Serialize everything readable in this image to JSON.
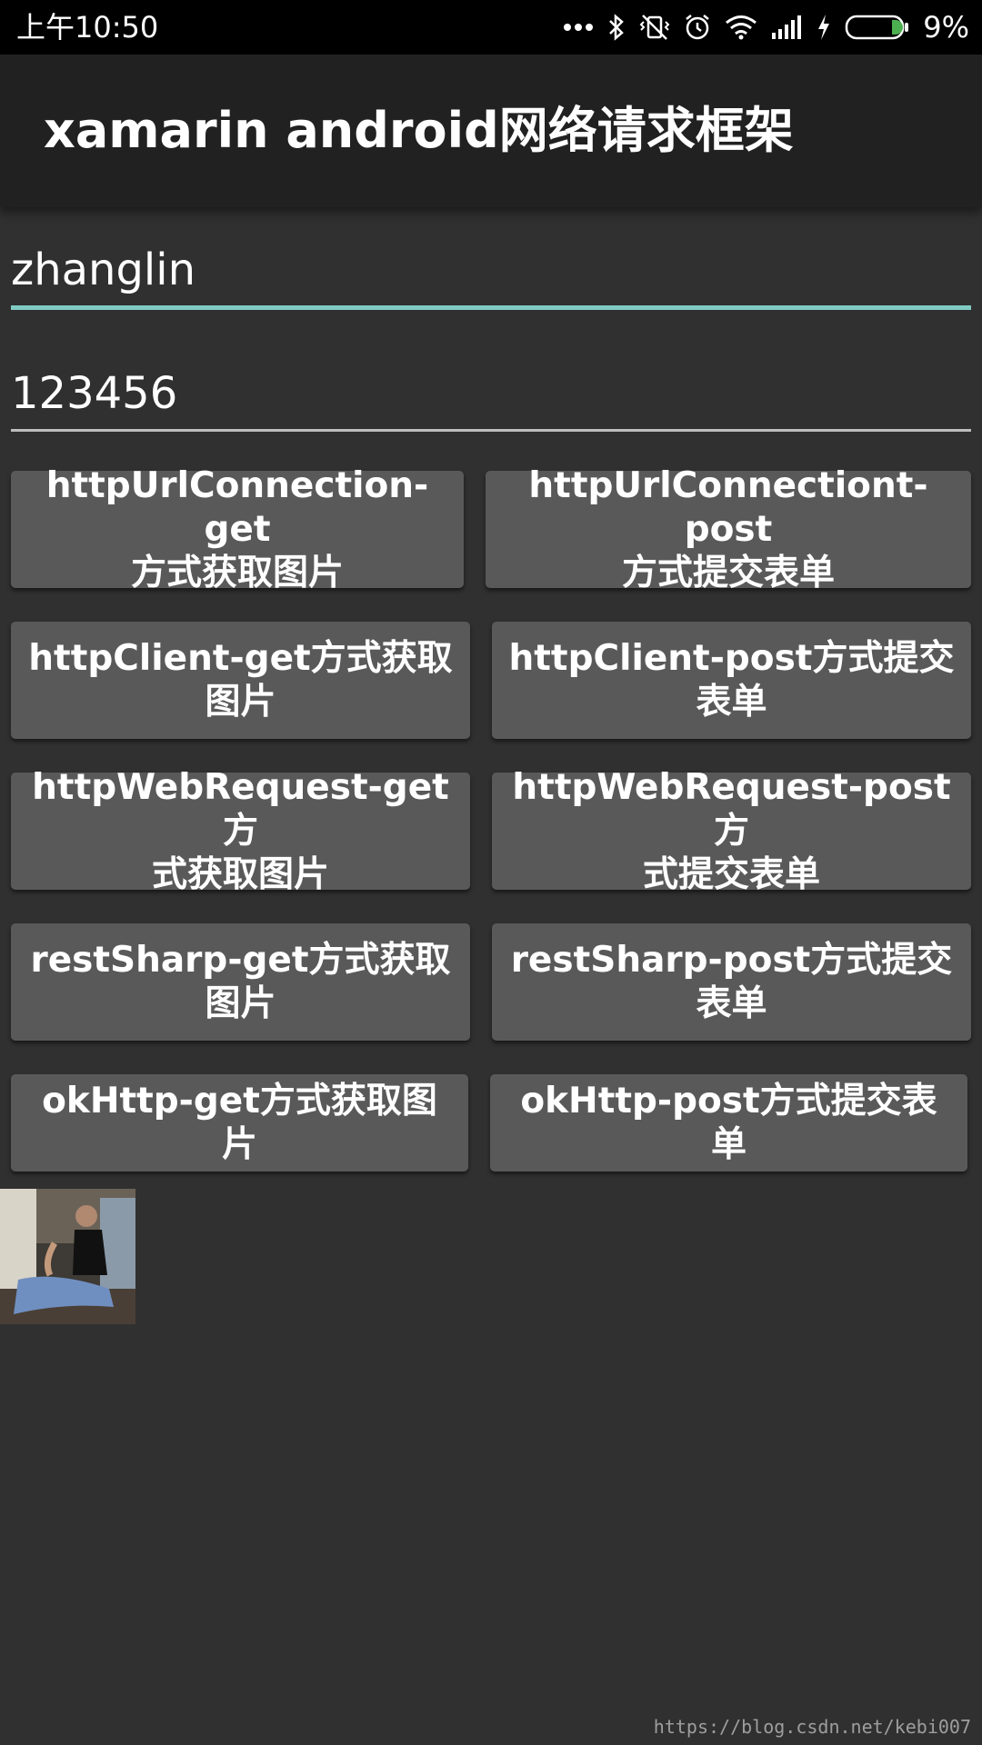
{
  "status_bar": {
    "time": "上午10:50",
    "battery": "9%",
    "icons": [
      "more-dots-icon",
      "bluetooth-icon",
      "vibrate-off-icon",
      "alarm-icon",
      "wifi-icon",
      "signal-icon",
      "charging-icon",
      "battery-icon"
    ]
  },
  "app_bar": {
    "title": "xamarin android网络请求框架"
  },
  "form": {
    "username_value": "zhanglin",
    "password_value": "123456",
    "accent_color": "#80cbc4"
  },
  "buttons": [
    {
      "line1": "httpUrlConnection-get",
      "line2": "方式获取图片"
    },
    {
      "line1": "httpUrlConnectiont-post",
      "line2": "方式提交表单"
    },
    {
      "line1": "httpClient-get方式获取",
      "line2": "图片"
    },
    {
      "line1": "httpClient-post方式提交",
      "line2": "表单"
    },
    {
      "line1": "httpWebRequest-get方",
      "line2": "式获取图片"
    },
    {
      "line1": "httpWebRequest-post方",
      "line2": "式提交表单"
    },
    {
      "line1": "restSharp-get方式获取",
      "line2": "图片"
    },
    {
      "line1": "restSharp-post方式提交",
      "line2": "表单"
    },
    {
      "line1": "okHttp-get方式获取图片"
    },
    {
      "line1": "okHttp-post方式提交表单"
    }
  ],
  "watermark": "https://blog.csdn.net/kebi007"
}
